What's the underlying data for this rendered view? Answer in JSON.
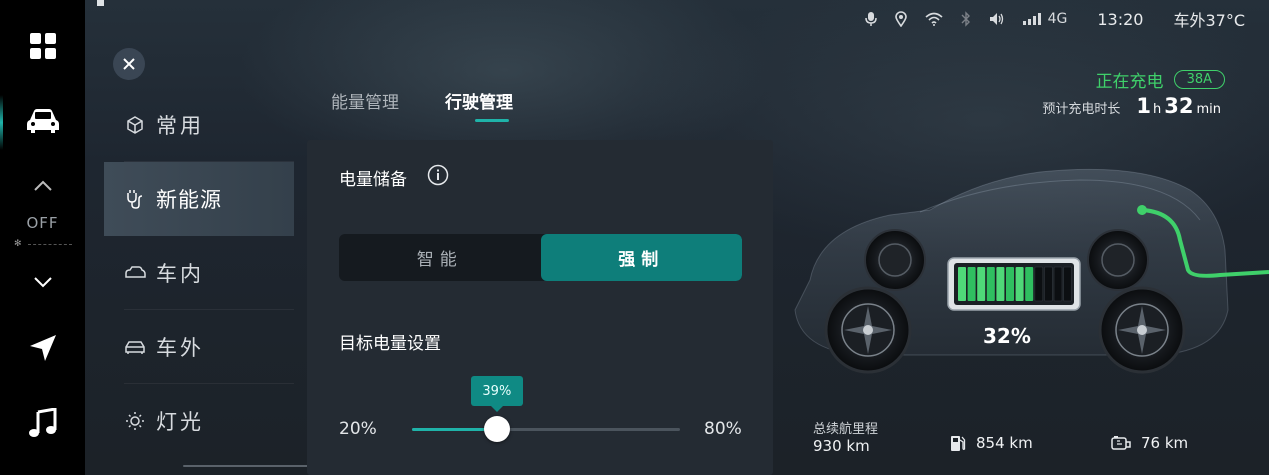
{
  "status_bar": {
    "network": "4G",
    "time": "13:20",
    "outside_temp": "车外37°C"
  },
  "left_rail": {
    "climate_state": "OFF",
    "icons": [
      "apps-grid-icon",
      "car-icon",
      "chevron-up-icon",
      "chevron-down-icon",
      "navigation-icon",
      "music-icon"
    ]
  },
  "menu": {
    "items": [
      {
        "label": "常用",
        "icon": "cube-icon"
      },
      {
        "label": "新能源",
        "icon": "charging-plug-icon",
        "active": true
      },
      {
        "label": "车内",
        "icon": "car-interior-icon"
      },
      {
        "label": "车外",
        "icon": "car-exterior-icon"
      },
      {
        "label": "灯光",
        "icon": "light-bulb-icon"
      }
    ]
  },
  "tabs": [
    {
      "label": "能量管理",
      "active": false
    },
    {
      "label": "行驶管理",
      "active": true
    }
  ],
  "energy_storage": {
    "title": "电量储备",
    "modes": [
      {
        "label": "智能",
        "selected": false
      },
      {
        "label": "强制",
        "selected": true
      }
    ]
  },
  "target_charge": {
    "title": "目标电量设置",
    "min_label": "20%",
    "max_label": "80%",
    "value_label": "39%",
    "value": 39,
    "min": 20,
    "max": 80
  },
  "charging": {
    "status": "正在充电",
    "current": "38A",
    "eta_label": "预计充电时长",
    "eta_hours": "1",
    "eta_hours_unit": "h",
    "eta_minutes": "32",
    "eta_minutes_unit": "min",
    "battery_percent": "32%",
    "battery_level": 0.32
  },
  "range": {
    "total_label": "总续航里程",
    "total_value": "930 km",
    "fuel_value": "854 km",
    "electric_value": "76 km"
  },
  "colors": {
    "accent": "#1fb3a9",
    "charging_green": "#3fd06a",
    "segment_on": "#0e7e7a"
  }
}
